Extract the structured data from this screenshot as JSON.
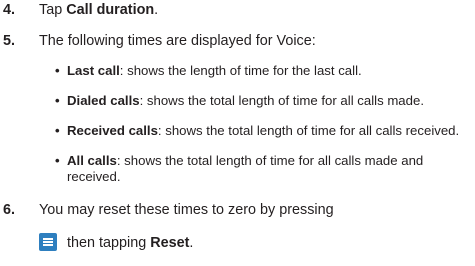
{
  "steps": [
    {
      "num": "4.",
      "pre": "Tap ",
      "bold": "Call duration",
      "post": "."
    },
    {
      "num": "5.",
      "text": "The following times are displayed for Voice:"
    },
    {
      "num": "6.",
      "line1": "You may reset these times to zero by pressing",
      "line2_pre": " then tapping ",
      "line2_bold": "Reset",
      "line2_post": "."
    }
  ],
  "bullets": [
    {
      "bullet": "•",
      "bold": "Last call",
      "text": ": shows the length of time for the last call."
    },
    {
      "bullet": "•",
      "bold": "Dialed calls",
      "text": ": shows the total length of time for all calls made."
    },
    {
      "bullet": "•",
      "bold": "Received calls",
      "text": ": shows the total length of time for all calls received."
    },
    {
      "bullet": "•",
      "bold": "All calls",
      "text": ": shows the total length of time for all calls made and",
      "text2": "received."
    }
  ],
  "icons": {
    "menu_key": "menu-key-icon",
    "accent": "#2e7fbf"
  }
}
